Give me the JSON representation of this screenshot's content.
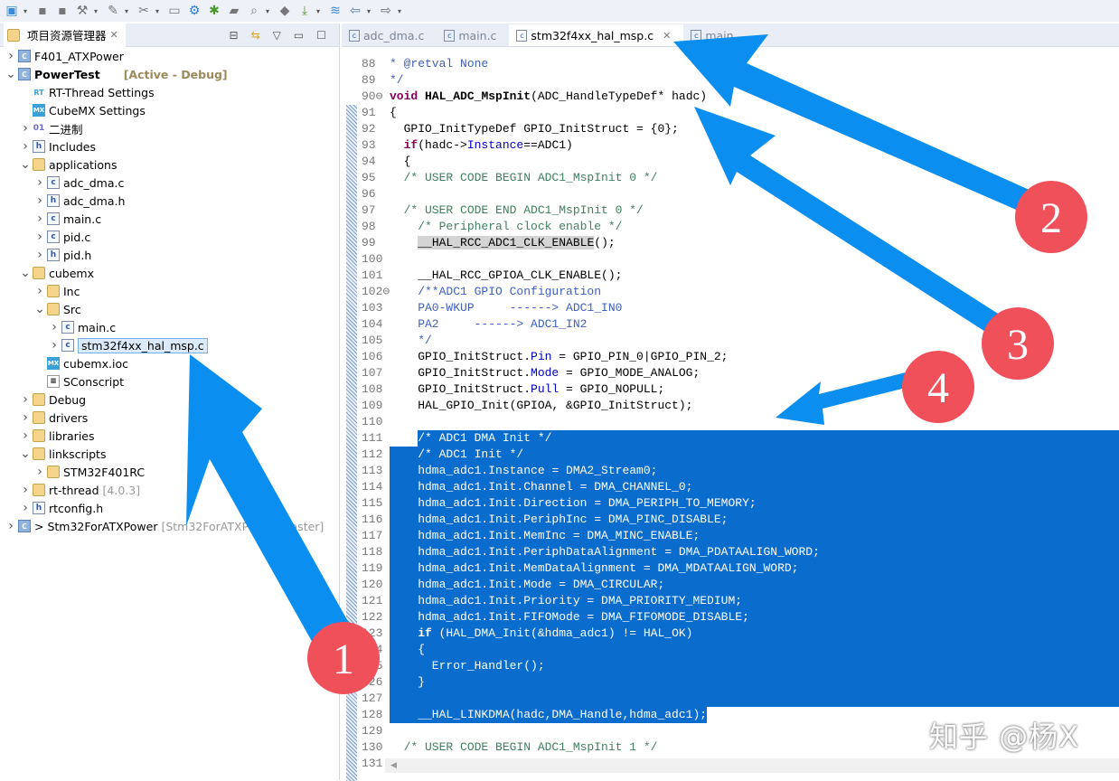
{
  "toolbar": {
    "icons": [
      "new-project-icon",
      "save-icon",
      "save-all-icon",
      "build-icon",
      "build-tools-icon",
      "settings-tools-icon",
      "monitor-icon",
      "gear-icon",
      "debug-bug-icon",
      "open-folder-icon",
      "search-icon",
      "bookmark-icon",
      "download-icon",
      "layers-icon",
      "back-arrow-icon",
      "forward-arrow-icon"
    ]
  },
  "explorer": {
    "title": "项目资源管理器",
    "tree": [
      {
        "label": "F401_ATXPower",
        "level": 0,
        "arrow": "right",
        "icon": "proj"
      },
      {
        "label": "PowerTest",
        "level": 0,
        "arrow": "down",
        "icon": "proj",
        "bold": true,
        "suffix": "[Active - Debug]",
        "suffix_color": "#9a8a5a"
      },
      {
        "label": "RT-Thread Settings",
        "level": 1,
        "arrow": "none",
        "icon": "rt"
      },
      {
        "label": "CubeMX Settings",
        "level": 1,
        "arrow": "none",
        "icon": "mx"
      },
      {
        "label": "二进制",
        "level": 1,
        "arrow": "right",
        "icon": "bin"
      },
      {
        "label": "Includes",
        "level": 1,
        "arrow": "right",
        "icon": "hfile"
      },
      {
        "label": "applications",
        "level": 1,
        "arrow": "down",
        "icon": "folder"
      },
      {
        "label": "adc_dma.c",
        "level": 2,
        "arrow": "right",
        "icon": "cfile"
      },
      {
        "label": "adc_dma.h",
        "level": 2,
        "arrow": "right",
        "icon": "hfile"
      },
      {
        "label": "main.c",
        "level": 2,
        "arrow": "right",
        "icon": "cfile"
      },
      {
        "label": "pid.c",
        "level": 2,
        "arrow": "right",
        "icon": "cfile"
      },
      {
        "label": "pid.h",
        "level": 2,
        "arrow": "right",
        "icon": "hfile"
      },
      {
        "label": "cubemx",
        "level": 1,
        "arrow": "down",
        "icon": "folder"
      },
      {
        "label": "Inc",
        "level": 2,
        "arrow": "right",
        "icon": "folder"
      },
      {
        "label": "Src",
        "level": 2,
        "arrow": "down",
        "icon": "folder"
      },
      {
        "label": "main.c",
        "level": 3,
        "arrow": "right",
        "icon": "cfile"
      },
      {
        "label": "stm32f4xx_hal_msp.c",
        "level": 3,
        "arrow": "right",
        "icon": "cfile",
        "selected": true
      },
      {
        "label": "cubemx.ioc",
        "level": 2,
        "arrow": "none",
        "icon": "mx"
      },
      {
        "label": "SConscript",
        "level": 2,
        "arrow": "none",
        "icon": "doc"
      },
      {
        "label": "Debug",
        "level": 1,
        "arrow": "right",
        "icon": "folder"
      },
      {
        "label": "drivers",
        "level": 1,
        "arrow": "right",
        "icon": "folder"
      },
      {
        "label": "libraries",
        "level": 1,
        "arrow": "right",
        "icon": "folder"
      },
      {
        "label": "linkscripts",
        "level": 1,
        "arrow": "down",
        "icon": "folder"
      },
      {
        "label": "STM32F401RC",
        "level": 2,
        "arrow": "right",
        "icon": "folder"
      },
      {
        "label": "rt-thread",
        "level": 1,
        "arrow": "right",
        "icon": "folder",
        "suffix": "[4.0.3]",
        "suffix_color": "#999999"
      },
      {
        "label": "rtconfig.h",
        "level": 1,
        "arrow": "right",
        "icon": "hfile"
      },
      {
        "label": "> Stm32ForATXPower",
        "level": 0,
        "arrow": "right",
        "icon": "proj",
        "suffix": "[Stm32ForATXPower master]",
        "suffix_color": "#999999"
      }
    ]
  },
  "editor": {
    "tabs": [
      {
        "label": "adc_dma.c",
        "active": false
      },
      {
        "label": "main.c",
        "active": false
      },
      {
        "label": "stm32f4xx_hal_msp.c",
        "active": true,
        "closable": true
      },
      {
        "label": "main",
        "active": false
      }
    ],
    "selection_color": "#0a6ccc",
    "lines": [
      {
        "n": "88",
        "t": [
          [
            "* @retval ",
            "d"
          ],
          [
            "None",
            "d"
          ]
        ]
      },
      {
        "n": "89",
        "t": [
          [
            "*/",
            "d"
          ]
        ]
      },
      {
        "n": "90⊖",
        "t": [
          [
            "void",
            "k"
          ],
          [
            " ",
            ""
          ],
          [
            "HAL_ADC_MspInit",
            "fn"
          ],
          [
            "(ADC_HandleTypeDef* hadc)",
            ""
          ]
        ]
      },
      {
        "n": "91",
        "t": [
          [
            "{",
            ""
          ]
        ]
      },
      {
        "n": "92",
        "t": [
          [
            "  GPIO_InitTypeDef GPIO_InitStruct = {0};",
            ""
          ]
        ]
      },
      {
        "n": "93",
        "t": [
          [
            "  ",
            ""
          ],
          [
            "if",
            "k"
          ],
          [
            "(hadc->",
            ""
          ],
          [
            "Instance",
            "f"
          ],
          [
            "==ADC1)",
            ""
          ]
        ]
      },
      {
        "n": "94",
        "t": [
          [
            "  {",
            ""
          ]
        ]
      },
      {
        "n": "95",
        "t": [
          [
            "  /* USER CODE BEGIN ADC1_MspInit 0 */",
            "c"
          ]
        ]
      },
      {
        "n": "96",
        "t": []
      },
      {
        "n": "97",
        "t": [
          [
            "  /* USER CODE END ADC1_MspInit 0 */",
            "c"
          ]
        ]
      },
      {
        "n": "98",
        "t": [
          [
            "    /* Peripheral clock enable */",
            "c"
          ]
        ]
      },
      {
        "n": "99",
        "t": [
          [
            "    ",
            ""
          ],
          [
            "__HAL_RCC_ADC1_CLK_ENABLE",
            "hl"
          ],
          [
            "();",
            ""
          ]
        ]
      },
      {
        "n": "100",
        "t": []
      },
      {
        "n": "101",
        "t": [
          [
            "    __HAL_RCC_GPIOA_CLK_ENABLE();",
            ""
          ]
        ]
      },
      {
        "n": "102⊖",
        "t": [
          [
            "    /**ADC1 GPIO Configuration",
            "d"
          ]
        ]
      },
      {
        "n": "103",
        "t": [
          [
            "    PA0-WKUP     ------> ADC1_IN0",
            "d"
          ]
        ]
      },
      {
        "n": "104",
        "t": [
          [
            "    PA2     ------> ADC1_IN2",
            "d"
          ]
        ]
      },
      {
        "n": "105",
        "t": [
          [
            "    */",
            "d"
          ]
        ]
      },
      {
        "n": "106",
        "t": [
          [
            "    GPIO_InitStruct.",
            ""
          ],
          [
            "Pin",
            "f"
          ],
          [
            " = GPIO_PIN_0|GPIO_PIN_2;",
            ""
          ]
        ]
      },
      {
        "n": "107",
        "t": [
          [
            "    GPIO_InitStruct.",
            ""
          ],
          [
            "Mode",
            "f"
          ],
          [
            " = GPIO_MODE_ANALOG;",
            ""
          ]
        ]
      },
      {
        "n": "108",
        "t": [
          [
            "    GPIO_InitStruct.",
            ""
          ],
          [
            "Pull",
            "f"
          ],
          [
            " = GPIO_NOPULL;",
            ""
          ]
        ]
      },
      {
        "n": "109",
        "t": [
          [
            "    HAL_GPIO_Init(GPIOA, &GPIO_InitStruct);",
            ""
          ]
        ]
      },
      {
        "n": "110",
        "t": []
      },
      {
        "n": "111",
        "t": [
          [
            "    /* ADC1 DMA Init */",
            "c"
          ]
        ]
      },
      {
        "n": "112",
        "t": [
          [
            "    /* ADC1 Init */",
            "c"
          ]
        ]
      },
      {
        "n": "113",
        "t": [
          [
            "    hdma_adc1.Instance = DMA2_Stream0;",
            ""
          ]
        ]
      },
      {
        "n": "114",
        "t": [
          [
            "    hdma_adc1.Init.Channel = DMA_CHANNEL_0;",
            ""
          ]
        ]
      },
      {
        "n": "115",
        "t": [
          [
            "    hdma_adc1.Init.Direction = DMA_PERIPH_TO_MEMORY;",
            ""
          ]
        ]
      },
      {
        "n": "116",
        "t": [
          [
            "    hdma_adc1.Init.PeriphInc = DMA_PINC_DISABLE;",
            ""
          ]
        ]
      },
      {
        "n": "117",
        "t": [
          [
            "    hdma_adc1.Init.MemInc = DMA_MINC_ENABLE;",
            ""
          ]
        ]
      },
      {
        "n": "118",
        "t": [
          [
            "    hdma_adc1.Init.PeriphDataAlignment = DMA_PDATAALIGN_WORD;",
            ""
          ]
        ]
      },
      {
        "n": "119",
        "t": [
          [
            "    hdma_adc1.Init.MemDataAlignment = DMA_MDATAALIGN_WORD;",
            ""
          ]
        ]
      },
      {
        "n": "120",
        "t": [
          [
            "    hdma_adc1.Init.Mode = DMA_CIRCULAR;",
            ""
          ]
        ]
      },
      {
        "n": "121",
        "t": [
          [
            "    hdma_adc1.Init.Priority = DMA_PRIORITY_MEDIUM;",
            ""
          ]
        ]
      },
      {
        "n": "122",
        "t": [
          [
            "    hdma_adc1.Init.FIFOMode = DMA_FIFOMODE_DISABLE;",
            ""
          ]
        ]
      },
      {
        "n": "123",
        "t": [
          [
            "    ",
            ""
          ],
          [
            "if",
            "k"
          ],
          [
            " (HAL_DMA_Init(&hdma_adc1) != HAL_OK)",
            ""
          ]
        ]
      },
      {
        "n": "124",
        "t": [
          [
            "    {",
            ""
          ]
        ]
      },
      {
        "n": "125",
        "t": [
          [
            "      Error_Handler();",
            ""
          ]
        ]
      },
      {
        "n": "126",
        "t": [
          [
            "    }",
            ""
          ]
        ]
      },
      {
        "n": "127",
        "t": []
      },
      {
        "n": "128",
        "t": [
          [
            "    __HAL_LINKDMA(hadc,DMA_Handle,hdma_adc1);",
            ""
          ]
        ]
      },
      {
        "n": "129",
        "t": []
      },
      {
        "n": "130",
        "t": [
          [
            "  /* USER CODE BEGIN ADC1_MspInit 1 */",
            "c"
          ]
        ]
      },
      {
        "n": "131",
        "t": []
      }
    ]
  },
  "annotations": {
    "color": "#f0505a",
    "arrow_color": "#0a8ef0",
    "labels": [
      "1",
      "2",
      "3",
      "4"
    ]
  },
  "watermark": "知乎 @杨X"
}
